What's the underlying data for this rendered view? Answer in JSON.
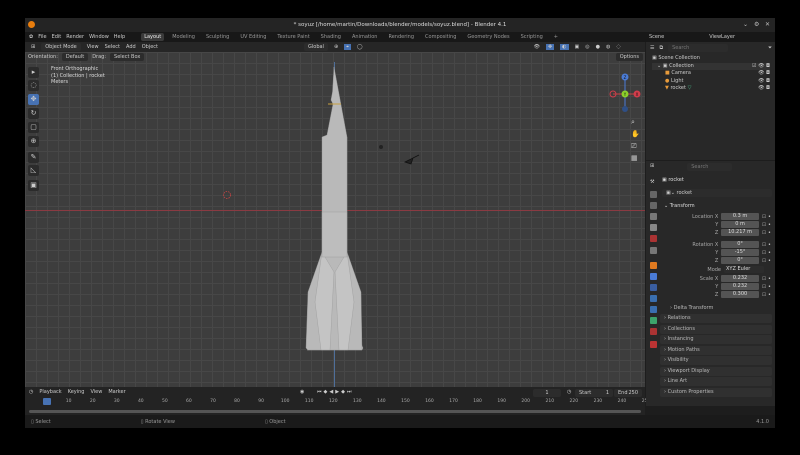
{
  "window": {
    "title": "* soyuz [/home/martin/Downloads/blender/models/soyuz.blend] - Blender 4.1",
    "controls": [
      "⌄",
      "⚙",
      "✕"
    ]
  },
  "menu": {
    "items": [
      "File",
      "Edit",
      "Render",
      "Window",
      "Help"
    ],
    "workspaces": [
      "Layout",
      "Modeling",
      "Sculpting",
      "UV Editing",
      "Texture Paint",
      "Shading",
      "Animation",
      "Rendering",
      "Compositing",
      "Geometry Nodes",
      "Scripting",
      "+"
    ],
    "active": "Layout"
  },
  "viewport_header": {
    "mode": "Object Mode",
    "menus": [
      "View",
      "Select",
      "Add",
      "Object"
    ],
    "transform": "Global",
    "options": "Options"
  },
  "tool_settings": {
    "orientation_label": "Orientation:",
    "orientation": "Default",
    "drag_label": "Drag:",
    "drag": "Select Box"
  },
  "overlay": {
    "view": "Front Orthographic",
    "collection": "(1) Collection | rocket",
    "units": "Meters"
  },
  "gizmo": {
    "z": "Z",
    "x": "X",
    "y": "Y"
  },
  "top_right": {
    "scene": "Scene",
    "view_layer": "ViewLayer"
  },
  "outliner": {
    "search_placeholder": "Search",
    "root": "Scene Collection",
    "collection": "Collection",
    "items": [
      "Camera",
      "Light",
      "rocket"
    ]
  },
  "properties": {
    "search_placeholder": "Search",
    "object": "rocket",
    "data_name": "rocket",
    "transform_title": "Transform",
    "location": [
      {
        "label": "Location X",
        "value": "0.3 m"
      },
      {
        "label": "Y",
        "value": "0 m"
      },
      {
        "label": "Z",
        "value": "10.217 m"
      }
    ],
    "rotation": [
      {
        "label": "Rotation X",
        "value": "0°"
      },
      {
        "label": "Y",
        "value": "-15°"
      },
      {
        "label": "Z",
        "value": "0°"
      }
    ],
    "mode_label": "Mode",
    "mode": "XYZ Euler",
    "scale": [
      {
        "label": "Scale X",
        "value": "0.232"
      },
      {
        "label": "Y",
        "value": "0.232"
      },
      {
        "label": "Z",
        "value": "0.300"
      }
    ],
    "delta": "Delta Transform",
    "panels": [
      "Relations",
      "Collections",
      "Instancing",
      "Motion Paths",
      "Visibility",
      "Viewport Display",
      "Line Art",
      "Custom Properties"
    ]
  },
  "timeline": {
    "menus": [
      "Playback",
      "Keying",
      "View",
      "Marker"
    ],
    "current_frame": "1",
    "start_label": "Start",
    "start": "1",
    "end_label": "End",
    "end": "250",
    "ticks": [
      "1",
      "10",
      "20",
      "30",
      "40",
      "50",
      "60",
      "70",
      "80",
      "90",
      "100",
      "110",
      "120",
      "130",
      "140",
      "150",
      "160",
      "170",
      "180",
      "190",
      "200",
      "210",
      "220",
      "230",
      "240",
      "250"
    ]
  },
  "status": {
    "items": [
      "Select",
      "Rotate View",
      "Object"
    ],
    "version": "4.1.0"
  }
}
